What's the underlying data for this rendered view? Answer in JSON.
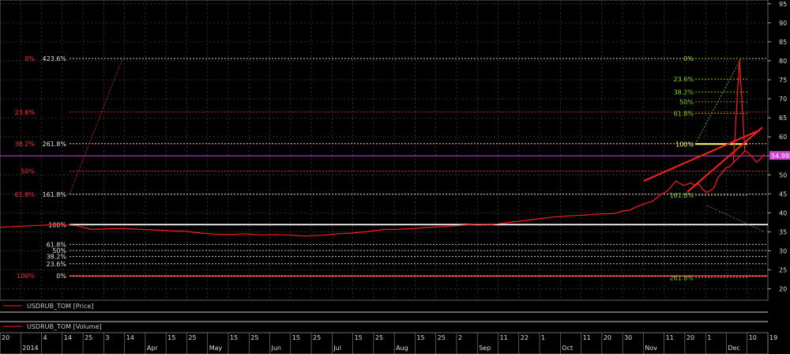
{
  "chart_data": {
    "type": "line",
    "title": "",
    "grid": true,
    "background": "#000000",
    "price_color": "#ff1a1a",
    "y_axis": {
      "side": "right",
      "ylim": [
        17,
        96
      ],
      "ticks": [
        20,
        25,
        30,
        35,
        40,
        45,
        50,
        55,
        60,
        65,
        70,
        75,
        80,
        85,
        90,
        95
      ]
    },
    "price_series": {
      "name": "USDRUB_TOM [Price]",
      "x": [
        0,
        0.02,
        0.04,
        0.06,
        0.08,
        0.1,
        0.12,
        0.14,
        0.16,
        0.18,
        0.2,
        0.22,
        0.24,
        0.26,
        0.28,
        0.3,
        0.32,
        0.34,
        0.36,
        0.38,
        0.4,
        0.42,
        0.44,
        0.46,
        0.48,
        0.5,
        0.52,
        0.54,
        0.56,
        0.58,
        0.6,
        0.62,
        0.64,
        0.66,
        0.68,
        0.7,
        0.72,
        0.74,
        0.76,
        0.78,
        0.8,
        0.81,
        0.82,
        0.83,
        0.84,
        0.85,
        0.86,
        0.87,
        0.88,
        0.89,
        0.9,
        0.905,
        0.91,
        0.915,
        0.92,
        0.925,
        0.93,
        0.935,
        0.94,
        0.945,
        0.95,
        0.955,
        0.96,
        0.965,
        0.97,
        0.975,
        0.98,
        0.985,
        0.99,
        0.995
      ],
      "y": [
        36.2,
        36.4,
        36.6,
        36.8,
        36.9,
        36.6,
        35.6,
        35.8,
        35.9,
        35.7,
        35.5,
        35.3,
        35.2,
        34.7,
        34.4,
        34.3,
        34.5,
        34.2,
        34.3,
        34.1,
        33.9,
        34.1,
        34.5,
        34.7,
        35.1,
        35.6,
        35.7,
        35.9,
        36.2,
        36.4,
        36.7,
        37.0,
        36.9,
        37.4,
        37.9,
        38.4,
        38.9,
        39.2,
        39.4,
        39.7,
        39.8,
        40.4,
        40.7,
        41.7,
        42.4,
        43.1,
        44.7,
        45.9,
        48.4,
        47.2,
        47.9,
        47.2,
        47.6,
        46.2,
        45.4,
        45.8,
        46.7,
        49.2,
        50.4,
        51.8,
        52.1,
        53.2,
        54.1,
        55.2,
        56.3,
        55.7,
        54.6,
        53.3,
        54.1,
        55.4
      ]
    },
    "volume_series": {
      "name": "USDRUB_TOM [Volume]"
    },
    "last_price_label": "54.992",
    "fib_levels_left": [
      {
        "label": "0%",
        "value": 80.6
      },
      {
        "label": "423.6%",
        "value": 80.6
      },
      {
        "label": "23.6%",
        "value": 66.5
      },
      {
        "label": "38.2%",
        "value": 58.2
      },
      {
        "label": "261.8%",
        "value": 58.2
      },
      {
        "label": "50%",
        "value": 51.0
      },
      {
        "label": "61.8%",
        "value": 44.9
      },
      {
        "label": "161.8%",
        "value": 44.9
      },
      {
        "label": "100%",
        "value": 36.9
      },
      {
        "label": "61.8%",
        "value": 31.7
      },
      {
        "label": "50%",
        "value": 30.1
      },
      {
        "label": "38.2%",
        "value": 28.5
      },
      {
        "label": "23.6%",
        "value": 26.6
      },
      {
        "label": "100%",
        "value": 23.4
      },
      {
        "label": "0%",
        "value": 23.4
      }
    ],
    "fib_levels_right": [
      {
        "label": "0%",
        "value": 80.6
      },
      {
        "label": "23.6%",
        "value": 75.2
      },
      {
        "label": "38.2%",
        "value": 71.8
      },
      {
        "label": "50%",
        "value": 69.2
      },
      {
        "label": "61.8%",
        "value": 66.2
      },
      {
        "label": "100%",
        "value": 58.1
      },
      {
        "label": "161.8%",
        "value": 44.6
      },
      {
        "label": "261.8%",
        "value": 22.9
      }
    ],
    "x_axis": {
      "labels": [
        "20",
        "2014",
        "4",
        "14",
        "25",
        "3",
        "14",
        "Apr",
        "15",
        "25",
        "May",
        "15",
        "25",
        "Jun",
        "15",
        "25",
        "Jul",
        "15",
        "25",
        "Aug",
        "15",
        "25",
        "2",
        "Sep",
        "11",
        "22",
        "1",
        "Oct",
        "11",
        "20",
        "30",
        "Nov",
        "11",
        "20",
        "1",
        "Dec",
        "10",
        "19"
      ]
    }
  }
}
